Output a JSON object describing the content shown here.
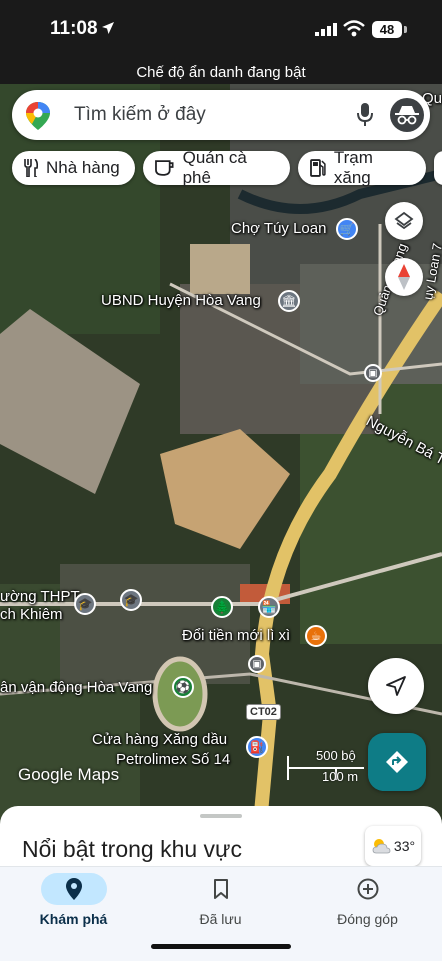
{
  "status_bar": {
    "time": "11:08",
    "battery": "48"
  },
  "incognito_banner": "Chế độ ẩn danh đang bật",
  "search": {
    "placeholder": "Tìm kiếm ở đây"
  },
  "chips": [
    {
      "label": "Nhà hàng",
      "icon": "fork-knife-icon"
    },
    {
      "label": "Quán cà phê",
      "icon": "coffee-cup-icon"
    },
    {
      "label": "Trạm xăng",
      "icon": "gas-pump-icon"
    }
  ],
  "map": {
    "labels": {
      "cho_tuy_loan": "Chợ Túy Loan",
      "ubnd": "UBND Huyện Hòa Vang",
      "quang_trong": "Quảng Trọng",
      "ngo_loan": "ụy Loan 7",
      "nguyen_ba": "Nguyễn Bá T",
      "thpt_1": "ường THPT",
      "thpt_2": "ch Khiêm",
      "doi_tien": "Đổi tiền mới lì xì",
      "van_dong": "ân vận động Hòa Vang",
      "road_ct02": "CT02",
      "cua_hang_1": "Cửa hàng Xăng dầu",
      "cua_hang_2": "Petrolimex Số 14",
      "top_right": "Qu"
    },
    "scale": {
      "ft": "500 bộ",
      "m": "100 m"
    },
    "attribution": "Google Maps"
  },
  "sheet": {
    "title": "Nổi bật trong khu vực"
  },
  "weather": {
    "temp": "33°",
    "icon": "partly-cloudy-icon"
  },
  "nav": [
    {
      "label": "Khám phá",
      "icon": "explore-pin-icon",
      "active": true
    },
    {
      "label": "Đã lưu",
      "icon": "bookmark-icon",
      "active": false
    },
    {
      "label": "Đóng góp",
      "icon": "add-circle-icon",
      "active": false
    }
  ],
  "colors": {
    "accent": "#0e7c86",
    "nav_active": "#c2e7ff",
    "road": "#e2c267"
  }
}
